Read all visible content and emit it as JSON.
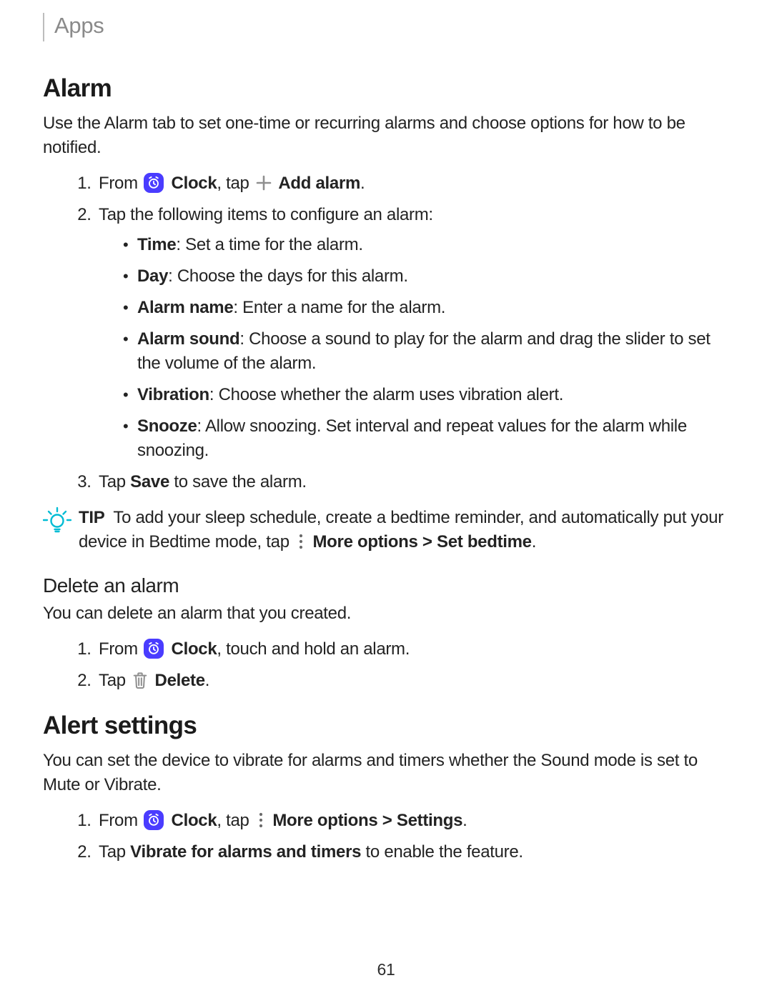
{
  "breadcrumb": "Apps",
  "page_number": "61",
  "sections": {
    "alarm": {
      "title": "Alarm",
      "intro": "Use the Alarm tab to set one-time or recurring alarms and choose options for how to be notified.",
      "step1_prefix": "From ",
      "clock_label": "Clock",
      "step1_mid": ", tap ",
      "add_alarm_label": "Add alarm",
      "step1_suffix": ".",
      "step2": "Tap the following items to configure an alarm:",
      "items": {
        "time": {
          "label": "Time",
          "text": ": Set a time for the alarm."
        },
        "day": {
          "label": "Day",
          "text": ": Choose the days for this alarm."
        },
        "name": {
          "label": "Alarm name",
          "text": ": Enter a name for the alarm."
        },
        "sound": {
          "label": "Alarm sound",
          "text": ": Choose a sound to play for the alarm and drag the slider to set the volume of the alarm."
        },
        "vibration": {
          "label": "Vibration",
          "text": ": Choose whether the alarm uses vibration alert."
        },
        "snooze": {
          "label": "Snooze",
          "text": ": Allow snoozing. Set interval and repeat values for the alarm while snoozing."
        }
      },
      "step3_prefix": "Tap ",
      "save_label": "Save",
      "step3_suffix": " to save the alarm."
    },
    "tip": {
      "label": "TIP",
      "text_before": "To add your sleep schedule, create a bedtime reminder, and automatically put your device in Bedtime mode, tap ",
      "more_options": "More options",
      "arrow": " > ",
      "set_bedtime": "Set bedtime",
      "suffix": "."
    },
    "delete": {
      "title": "Delete an alarm",
      "intro": "You can delete an alarm that you created.",
      "step1_prefix": "From ",
      "clock_label": "Clock",
      "step1_suffix": ", touch and hold an alarm.",
      "step2_prefix": "Tap ",
      "delete_label": "Delete",
      "step2_suffix": "."
    },
    "alert": {
      "title": "Alert settings",
      "intro": "You can set the device to vibrate for alarms and timers whether the Sound mode is set to Mute or Vibrate.",
      "step1_prefix": "From ",
      "clock_label": "Clock",
      "step1_mid": ", tap ",
      "more_options": "More options",
      "arrow": " > ",
      "settings": "Settings",
      "step1_suffix": ".",
      "step2_prefix": "Tap ",
      "vibrate_label": "Vibrate for alarms and timers",
      "step2_suffix": " to enable the feature."
    }
  }
}
